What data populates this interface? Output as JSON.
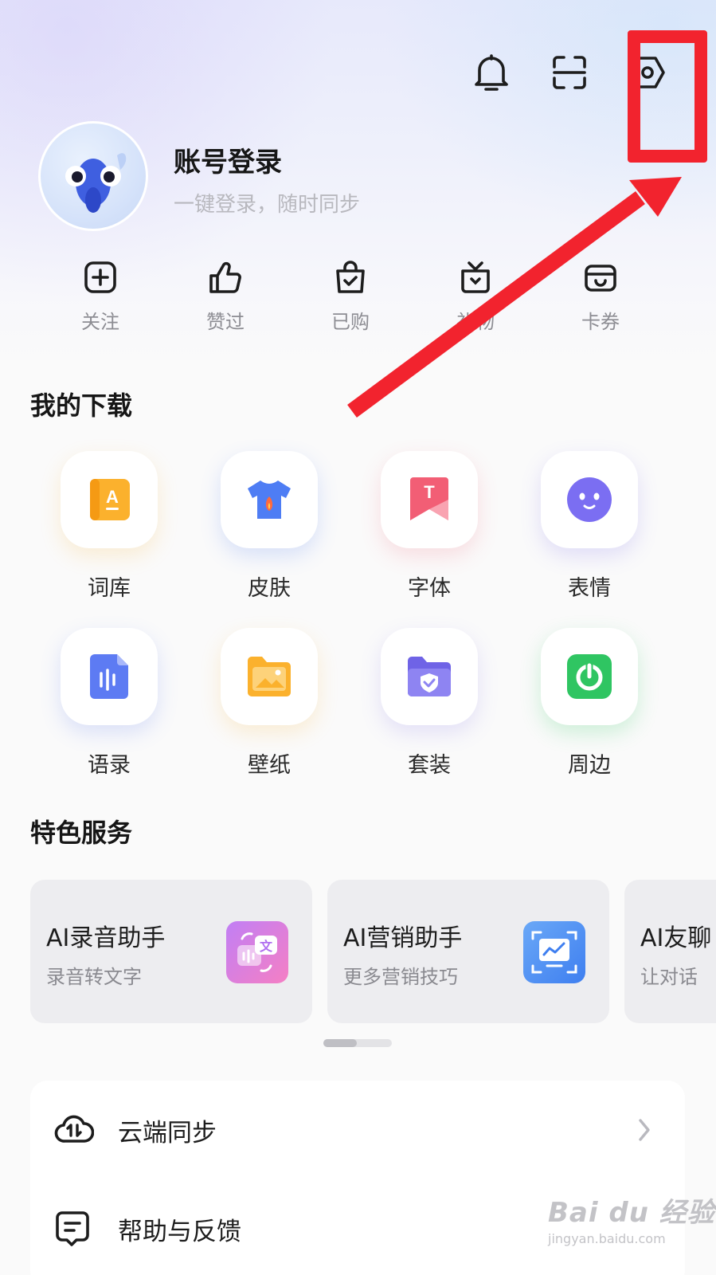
{
  "header": {
    "icons": [
      "bell-icon",
      "scan-icon",
      "settings-hexagon-icon"
    ]
  },
  "profile": {
    "title": "账号登录",
    "subtitle": "一键登录，随时同步"
  },
  "quick_actions": [
    {
      "label": "关注",
      "icon": "plus-square-icon"
    },
    {
      "label": "赞过",
      "icon": "thumbs-up-icon"
    },
    {
      "label": "已购",
      "icon": "shopping-bag-check-icon"
    },
    {
      "label": "礼物",
      "icon": "gift-box-icon"
    },
    {
      "label": "卡券",
      "icon": "wallet-card-icon"
    }
  ],
  "downloads": {
    "title": "我的下载",
    "items": [
      {
        "label": "词库",
        "icon": "lexicon-book-icon",
        "color": "#fbb12d"
      },
      {
        "label": "皮肤",
        "icon": "skin-shirt-icon",
        "color": "#4e7df4"
      },
      {
        "label": "字体",
        "icon": "font-bookmark-icon",
        "color": "#f25e75"
      },
      {
        "label": "表情",
        "icon": "emoji-face-icon",
        "color": "#7b6ef2"
      },
      {
        "label": "语录",
        "icon": "quote-audio-icon",
        "color": "#5d7bf3"
      },
      {
        "label": "壁纸",
        "icon": "wallpaper-folder-icon",
        "color": "#fbb12d"
      },
      {
        "label": "套装",
        "icon": "suit-folder-icon",
        "color": "#7f71ee"
      },
      {
        "label": "周边",
        "icon": "merch-power-icon",
        "color": "#33cc66"
      }
    ]
  },
  "services": {
    "title": "特色服务",
    "cards": [
      {
        "title": "AI录音助手",
        "subtitle": "录音转文字",
        "icon": "ai-record-translate-icon"
      },
      {
        "title": "AI营销助手",
        "subtitle": "更多营销技巧",
        "icon": "ai-marketing-chart-icon"
      },
      {
        "title": "AI友聊",
        "subtitle": "让对话",
        "icon": "ai-chat-icon"
      }
    ]
  },
  "list": [
    {
      "label": "云端同步",
      "icon": "cloud-sync-icon"
    },
    {
      "label": "帮助与反馈",
      "icon": "feedback-message-icon"
    }
  ],
  "annotation": {
    "color": "#f2232e"
  },
  "watermark": {
    "logo": "Bai du 经验",
    "url": "jingyan.baidu.com"
  }
}
